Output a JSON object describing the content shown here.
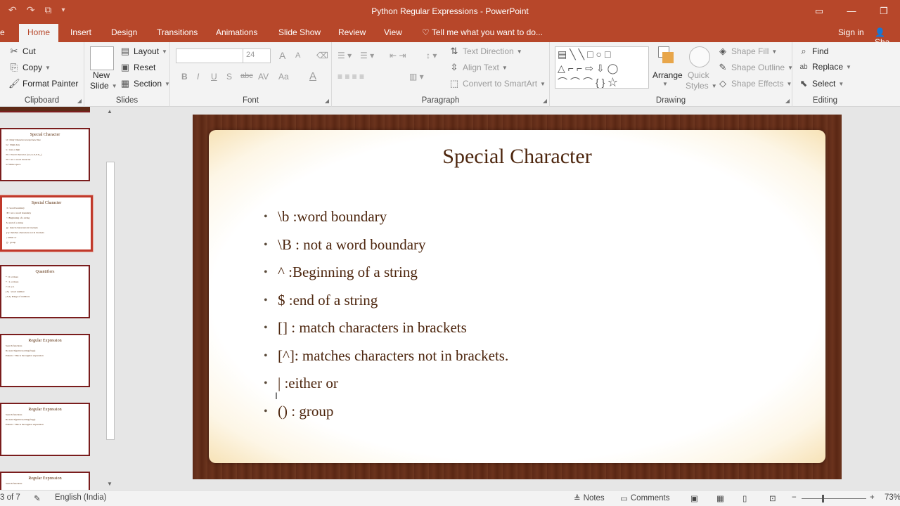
{
  "window": {
    "title": "Python Regular Expressions - PowerPoint",
    "qat_icons": [
      "undo-icon",
      "redo-icon",
      "start-from-beginning-icon",
      "customize-qat-icon"
    ]
  },
  "tabs": {
    "file_partial": "e",
    "items": [
      "Home",
      "Insert",
      "Design",
      "Transitions",
      "Animations",
      "Slide Show",
      "Review",
      "View"
    ],
    "tell_me": "Tell me what you want to do...",
    "sign_in": "Sign in",
    "share": "Sha"
  },
  "ribbon": {
    "clipboard": {
      "label": "Clipboard",
      "cut": "Cut",
      "copy": "Copy",
      "format_painter": "Format Painter"
    },
    "slides": {
      "label": "Slides",
      "new_slide_1": "New",
      "new_slide_2": "Slide",
      "layout": "Layout",
      "reset": "Reset",
      "section": "Section"
    },
    "font": {
      "label": "Font",
      "size": "24",
      "bold": "B",
      "italic": "I",
      "underline": "U",
      "shadow": "S",
      "strike": "abc",
      "spacing": "AV",
      "case": "Aa",
      "color": "A",
      "grow": "A",
      "shrink": "A"
    },
    "paragraph": {
      "label": "Paragraph",
      "text_direction": "Text Direction",
      "align_text": "Align Text",
      "convert_smartart": "Convert to SmartArt"
    },
    "drawing": {
      "label": "Drawing",
      "arrange": "Arrange",
      "quick_styles_1": "Quick",
      "quick_styles_2": "Styles",
      "shape_fill": "Shape Fill",
      "shape_outline": "Shape Outline",
      "shape_effects": "Shape Effects"
    },
    "editing": {
      "label": "Editing",
      "find": "Find",
      "replace": "Replace",
      "select": "Select"
    }
  },
  "thumbnails": [
    {
      "title": "Special Character",
      "lines": [
        "\\d : Only Character except new line",
        "\\w : Digit Any",
        "\\s : non-a digit",
        "\\W : Word Character (a-z,A-Z,0-9,_)",
        "\\W : not a word character",
        "\\s: White space"
      ],
      "selected": false
    },
    {
      "title": "Special Character",
      "lines": [
        "\\b :word boundary",
        "\\B : not a word boundary",
        "^ :Beginning of a string",
        "$ :end of a string",
        "[] : match characters in brackets",
        "[^]: matches characters not in brackets",
        "| :either or",
        "() : group"
      ],
      "selected": true
    },
    {
      "title": "Quantifiers",
      "lines": [
        "* : 0 or more",
        "+ : 1 or more",
        "? : 0 or 1",
        "{3} : exact number",
        "{3,4} Range of numbers"
      ],
      "selected": false
    },
    {
      "title": "Regular Expression",
      "lines": [
        "Search functions",
        "Re.search(pattern,string,flags)",
        "Pattern : This is the regular expression"
      ],
      "selected": false
    },
    {
      "title": "Regular Expression",
      "lines": [
        "Search functions",
        "Re.search(pattern,string,flags)",
        "Pattern : This is the regular expression"
      ],
      "selected": false
    },
    {
      "title": "Regular Expression",
      "lines": [
        "Search functions"
      ],
      "selected": false
    }
  ],
  "slide": {
    "title": "Special Character",
    "bullets": [
      "\\b :word boundary",
      "\\B : not a word boundary",
      "^ :Beginning of a string",
      "$ :end of a string",
      "[] : match characters in brackets",
      "[^]: matches characters not in brackets.",
      "| :either or",
      "() : group"
    ]
  },
  "status": {
    "slide_count": "3 of 7",
    "language": "English (India)",
    "notes": "Notes",
    "comments": "Comments",
    "zoom": "73%"
  }
}
